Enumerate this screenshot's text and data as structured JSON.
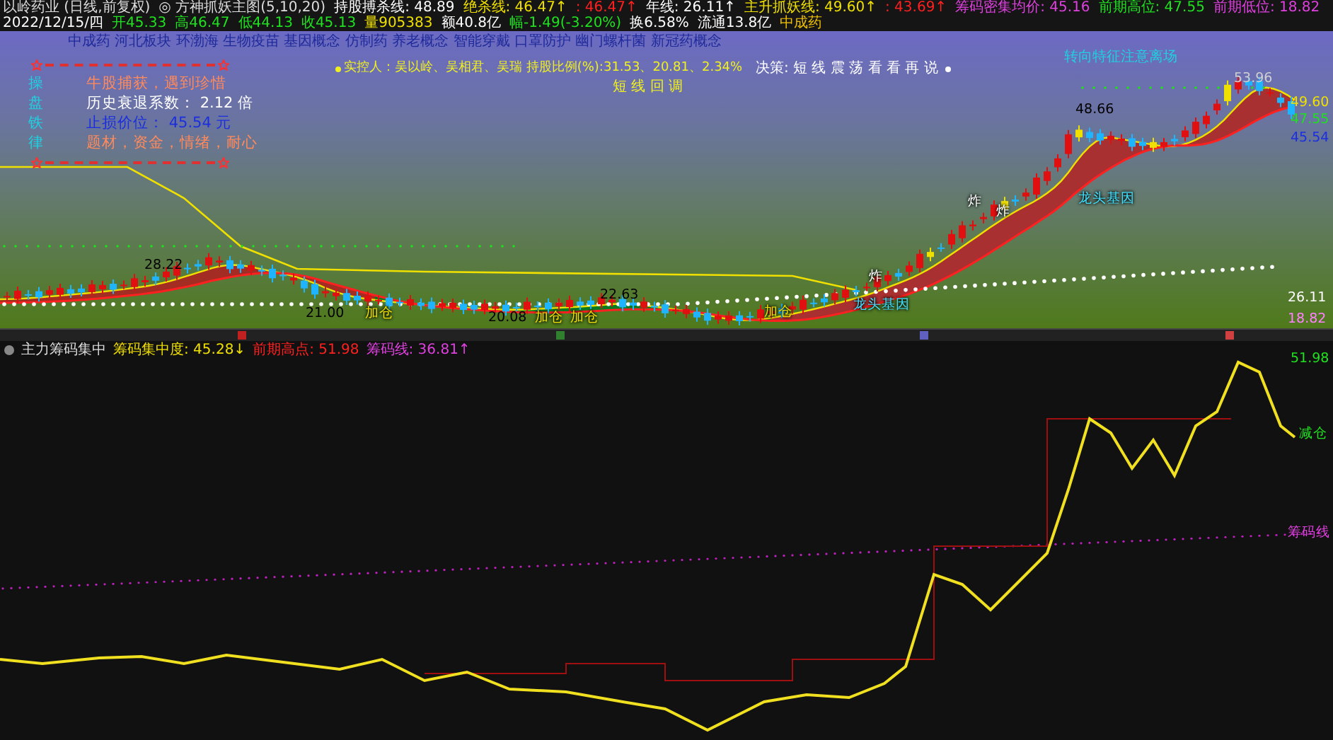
{
  "title_bar": {
    "stock": "以岭药业 (日线,前复权)",
    "indicator": "◎ 方神抓妖主图(5,10,20)",
    "values": [
      {
        "text": "持股搏杀线: 48.89",
        "color": "#ffffff"
      },
      {
        "text": "绝杀线: 46.47↑",
        "color": "#f0e000"
      },
      {
        "text": ": 46.47↑",
        "color": "#ff2020"
      },
      {
        "text": "年线: 26.11↑",
        "color": "#ffffff"
      },
      {
        "text": "主升抓妖线: 49.60↑",
        "color": "#f0e000"
      },
      {
        "text": ": 43.69↑",
        "color": "#ff2020"
      },
      {
        "text": "筹码密集均价: 45.16",
        "color": "#e040e0"
      },
      {
        "text": "前期高位: 47.55",
        "color": "#20e020"
      },
      {
        "text": "前期低位: 18.82",
        "color": "#e040e0"
      }
    ]
  },
  "quote_bar": {
    "fields": [
      {
        "text": "2022/12/15/四",
        "color": "#ffffff"
      },
      {
        "text": "开45.33",
        "color": "#20e020"
      },
      {
        "text": "高46.47",
        "color": "#20e020"
      },
      {
        "text": "低44.13",
        "color": "#20e020"
      },
      {
        "text": "收45.13",
        "color": "#20e020"
      },
      {
        "text": "量905383",
        "color": "#f0e000"
      },
      {
        "text": "额40.8亿",
        "color": "#ffffff"
      },
      {
        "text": "幅-1.49(-3.20%)",
        "color": "#20e020"
      },
      {
        "text": "换6.58%",
        "color": "#ffffff"
      },
      {
        "text": "流通13.8亿",
        "color": "#ffffff"
      },
      {
        "text": "中成药",
        "color": "#f0c000"
      }
    ]
  },
  "main_chart": {
    "concepts": "中成药 河北板块 环渤海 生物疫苗 基因概念 仿制药 养老概念 智能穿戴 口罩防护 幽门螺杆菌 新冠药概念",
    "info_rows": [
      {
        "key": "操",
        "text": "牛股捕获，遇到珍惜",
        "color": "#ff8a5c"
      },
      {
        "key": "盘",
        "text": "历史衰退系数：  2.12 倍",
        "color": "#ffffff"
      },
      {
        "key": "铁",
        "text": "止损价位：  45.54 元",
        "color": "#1a2ee0"
      },
      {
        "key": "律",
        "text": "题材，资金，情绪，耐心",
        "color": "#ff8a5c"
      }
    ],
    "holders": "实控人：吴以岭、吴相君、吴瑞 持股比例(%):31.53、20.81、2.34%",
    "signal": "短 线 回 调",
    "decision": "决策: 短 线 震 荡 看 看 再 说",
    "warning": "转向特征注意离场",
    "price_labels": [
      "53.96",
      "48.66",
      "49.60",
      "47.55",
      "45.54",
      "28.22",
      "26.11",
      "21.00",
      "20.08",
      "22.63",
      "18.82"
    ],
    "annotations": [
      "炸",
      "炸",
      "炸",
      "龙头基因",
      "龙头基因",
      "加仓",
      "加仓",
      "加仓",
      "加仓"
    ]
  },
  "sub_chart": {
    "name": "主力筹码集中",
    "values": [
      {
        "text": "筹码集中度: 45.28↓",
        "color": "#f0e000"
      },
      {
        "text": "前期高点: 51.98",
        "color": "#ff2020"
      },
      {
        "text": "筹码线: 36.81↑",
        "color": "#e040e0"
      }
    ],
    "labels": [
      "51.98",
      "减仓",
      "筹码线"
    ]
  }
}
